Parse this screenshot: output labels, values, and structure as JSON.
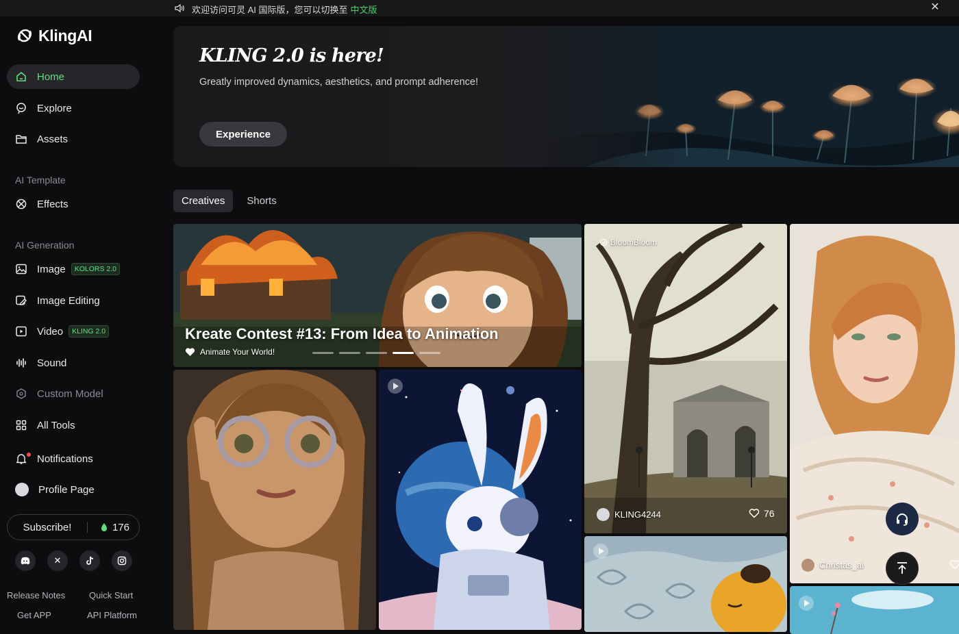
{
  "announcement": {
    "text": "欢迎访问可灵 AI 国际版，您可以切换至",
    "link": "中文版"
  },
  "brand": {
    "name": "KlingAI"
  },
  "nav": {
    "home": "Home",
    "explore": "Explore",
    "assets": "Assets",
    "ai_template_label": "AI Template",
    "effects": "Effects",
    "ai_generation_label": "AI Generation",
    "image": "Image",
    "image_badge": "KOLORS 2.0",
    "image_editing": "Image Editing",
    "video": "Video",
    "video_badge": "KLING 2.0",
    "sound": "Sound",
    "custom_model": "Custom Model",
    "all_tools": "All Tools",
    "notifications": "Notifications",
    "profile": "Profile Page"
  },
  "subscribe": {
    "label": "Subscribe!",
    "credits": "176"
  },
  "footer": {
    "release_notes": "Release Notes",
    "quick_start": "Quick Start",
    "get_app": "Get APP",
    "api_platform": "API Platform"
  },
  "banner": {
    "title": "KLING 2.0 is here!",
    "subtitle": "Greatly improved dynamics, aesthetics, and prompt adherence!",
    "button": "Experience"
  },
  "tabs": [
    "Creatives",
    "Shorts"
  ],
  "feed": {
    "hero": {
      "title": "Kreate Contest #13: From Idea to Animation",
      "subtitle": "Animate Your World!",
      "slide_count": 5,
      "active_slide": 4
    },
    "forest_card": {
      "tag": "BloomBloom",
      "user": "KLING4244",
      "likes": "76"
    },
    "portrait_card": {
      "user": "Christas_ai"
    }
  },
  "colors": {
    "accent": "#5fe07d",
    "background": "#0d0d0f",
    "panel": "#1c1c1f"
  }
}
